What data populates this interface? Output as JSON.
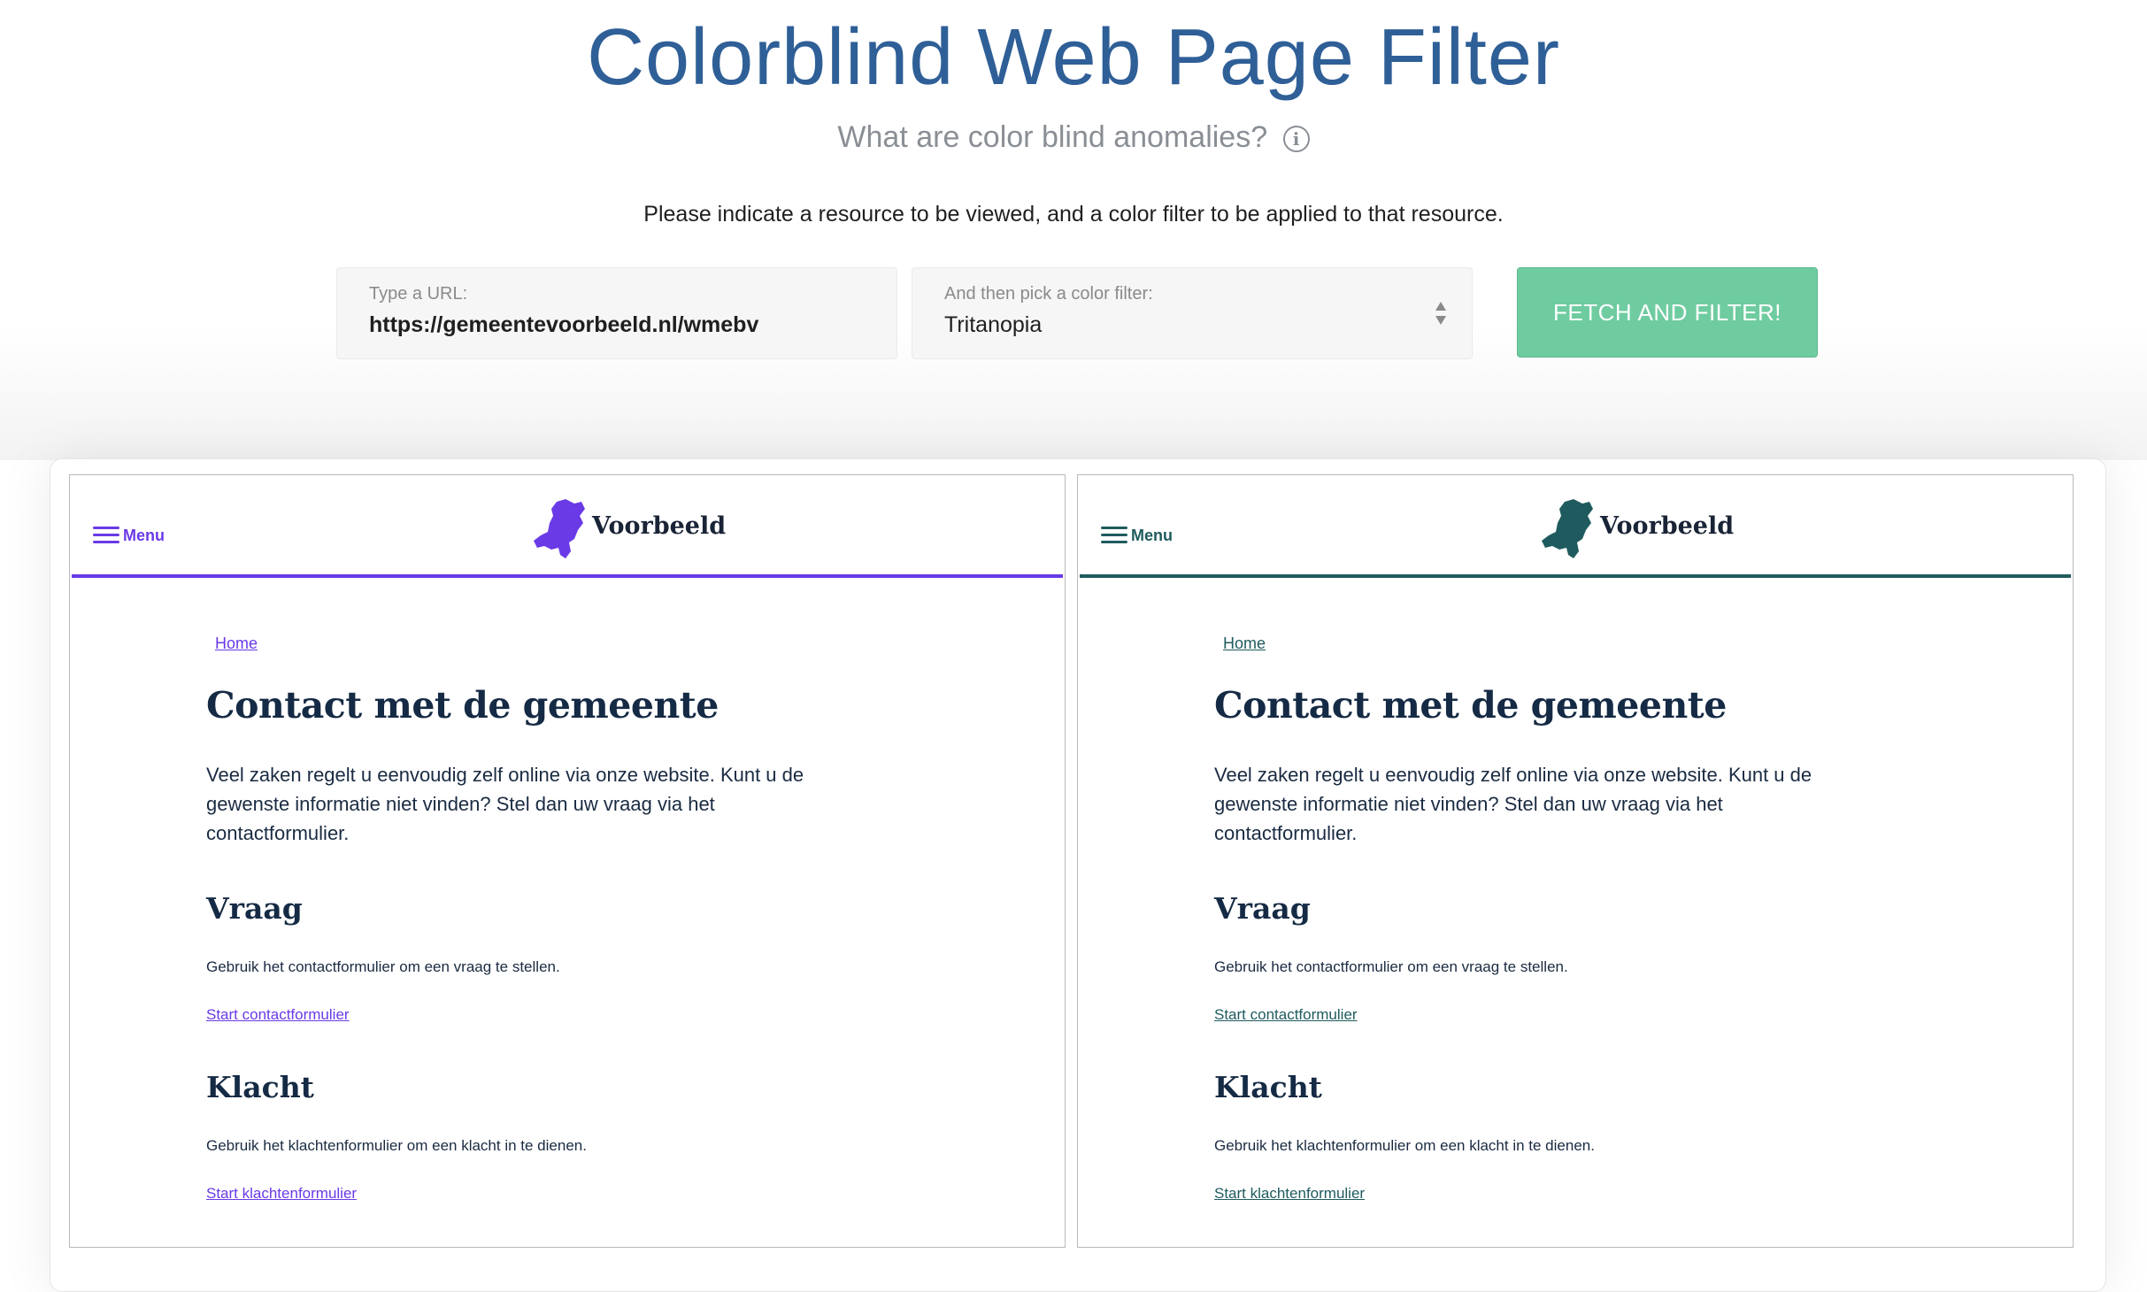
{
  "header": {
    "title": "Colorblind Web Page Filter",
    "subtitle": "What are color blind anomalies?",
    "instruction": "Please indicate a resource to be viewed, and a color filter to be applied to that resource."
  },
  "form": {
    "url_label": "Type a URL:",
    "url_value": "https://gemeentevoorbeeld.nl/wmebv",
    "filter_label": "And then pick a color filter:",
    "filter_value": "Tritanopia",
    "submit_label": "FETCH AND FILTER!"
  },
  "preview": {
    "menu_label": "Menu",
    "brand": "Voorbeeld",
    "breadcrumb": "Home",
    "heading": "Contact met de gemeente",
    "intro": "Veel zaken regelt u eenvoudig zelf online via onze website. Kunt u de gewenste informatie niet vinden? Stel dan uw vraag via het contactformulier.",
    "sections": [
      {
        "title": "Vraag",
        "text": "Gebruik het contactformulier om een vraag te stellen.",
        "link": "Start contactformulier"
      },
      {
        "title": "Klacht",
        "text": "Gebruik het klachtenformulier om een klacht in te dienen.",
        "link": "Start klachtenformulier"
      }
    ]
  },
  "colors": {
    "title": "#2f5f97",
    "button": "#6fcca0",
    "original_accent": "#6a3ae6",
    "filtered_accent": "#1f5b5e"
  },
  "icons": [
    "info-icon",
    "select-arrows-icon",
    "hamburger-icon",
    "netherlands-map-logo"
  ]
}
